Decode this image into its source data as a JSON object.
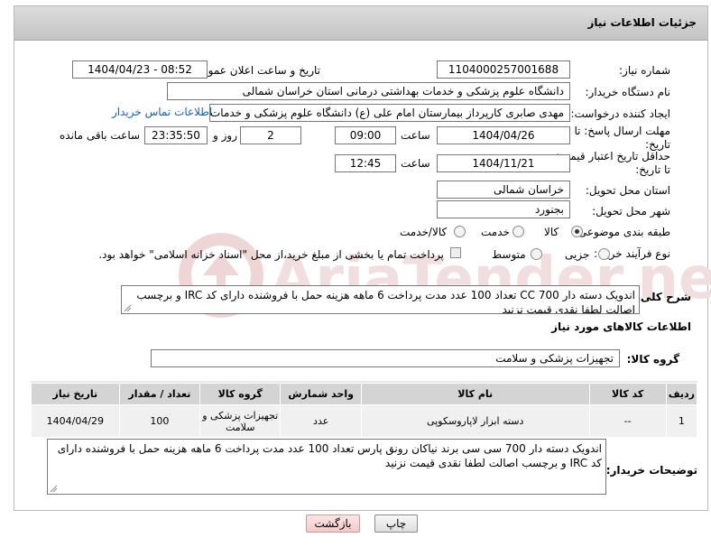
{
  "header": {
    "title": "جزئیات اطلاعات نیاز"
  },
  "form": {
    "need_number_label": "شماره نیاز:",
    "need_number": "1104000257001688",
    "announce_label": "تاریخ و ساعت اعلان عمومی:",
    "announce_value": "1404/04/23 - 08:52",
    "buyer_label": "نام دستگاه خریدار:",
    "buyer_value": "دانشگاه علوم پزشکی و خدمات بهداشتی درمانی استان خراسان شمالی",
    "creator_label": "ایجاد کننده درخواست:",
    "creator_value": "مهدی صابری کارپرداز بیمارستان امام علی (ع) دانشگاه علوم پزشکی و خدمات بهداشتی",
    "contact_link": "اطلاعات تماس خریدار",
    "reply_deadline_label": "مهلت ارسال پاسخ: تا تاریخ:",
    "reply_date": "1404/04/26",
    "time_label": "ساعت",
    "reply_time": "09:00",
    "days_value": "2",
    "days_label": "روز و",
    "remaining_value": "23:35:50",
    "remaining_label": "ساعت باقی مانده",
    "price_validity_label": "حداقل تاریخ اعتبار قیمت: تا تاریخ:",
    "price_date": "1404/11/21",
    "price_time": "12:45",
    "province_label": "استان محل تحویل:",
    "province_value": "خراسان شمالی",
    "city_label": "شهر محل تحویل:",
    "city_value": "بجنورد",
    "category_label": "طبقه بندی موضوعی:",
    "category_options": [
      "کالا",
      "خدمت",
      "کالا/خدمت"
    ],
    "process_label": "نوع فرآیند خرید :",
    "process_options": [
      "جزیی",
      "متوسط"
    ],
    "payment_note": "پرداخت تمام یا بخشی از مبلغ خرید،از محل \"اسناد خزانه اسلامی\" خواهد بود."
  },
  "description": {
    "label": "شرح کلی نیاز:",
    "text": "اندویک دسته دار CC 700 تعداد 100 عدد مدت پرداخت 6 ماهه هزینه حمل با فروشنده دارای کد IRC و برچسب اصالت  لطفا نقدی قیمت نزنید"
  },
  "goods": {
    "section_title": "اطلاعات کالاهای مورد نیاز",
    "group_label": "گروه کالا:",
    "group_value": "تجهیزات پزشکی و سلامت",
    "columns": [
      "ردیف",
      "کد کالا",
      "نام کالا",
      "واحد شمارش",
      "گروه کالا",
      "تعداد / مقدار",
      "تاریخ نیاز"
    ],
    "rows": [
      [
        "1",
        "--",
        "دسته ابزار لاپاروسکوپی",
        "عدد",
        "تجهیزات پزشکی و سلامت",
        "100",
        "1404/04/29"
      ]
    ]
  },
  "buyer_notes": {
    "label": "توضیحات خریدار:",
    "text": "اندویک دسته دار 700 سی سی برند نیاکان رونق پارس  تعداد 100 عدد مدت پرداخت 6 ماهه هزینه حمل با فروشنده دارای کد IRC و برچسب اصالت  لطفا نقدی قیمت نزنید"
  },
  "buttons": {
    "print": "چاپ",
    "back": "بازگشت"
  },
  "colors": {
    "link": "#1a5fb4",
    "header_bg": "#cfcfcf",
    "watermark": "#e8c9c9"
  }
}
